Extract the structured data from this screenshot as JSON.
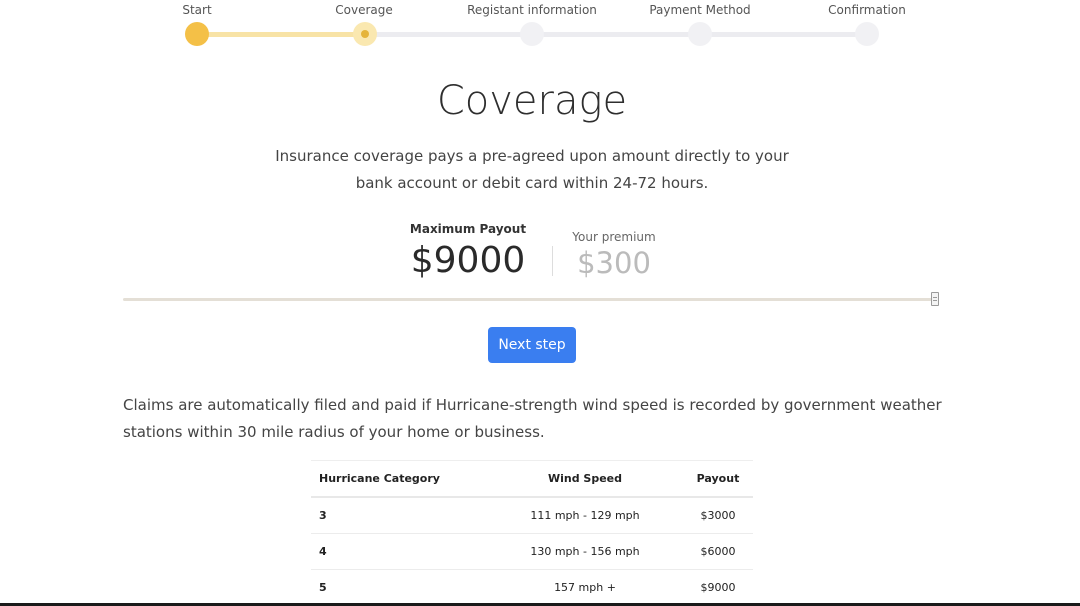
{
  "stepper": {
    "steps": [
      {
        "label": "Start",
        "state": "done"
      },
      {
        "label": "Coverage",
        "state": "current"
      },
      {
        "label": "Registant information",
        "state": "pending"
      },
      {
        "label": "Payment Method",
        "state": "pending"
      },
      {
        "label": "Confirmation",
        "state": "pending"
      }
    ],
    "colors": {
      "done": "#f4c047",
      "current": "#fae8b0",
      "pending": "#f1f1f4"
    }
  },
  "page": {
    "title": "Coverage",
    "intro": "Insurance coverage pays a pre-agreed upon amount directly to your bank account or debit card within 24-72 hours."
  },
  "coverage": {
    "max_payout_label": "Maximum Payout",
    "max_payout_value": "$9000",
    "premium_label": "Your premium",
    "premium_value": "$300",
    "slider_level": 1.0
  },
  "actions": {
    "next_label": "Next step",
    "accent_color": "#3a7ef0"
  },
  "claims_text": "Claims are automatically filed and paid if Hurricane-strength wind speed is recorded by government weather stations within 30 mile radius of your home or business.",
  "table": {
    "headers": [
      "Hurricane Category",
      "Wind Speed",
      "Payout"
    ],
    "rows": [
      [
        "3",
        "111 mph - 129 mph",
        "$3000"
      ],
      [
        "4",
        "130 mph - 156 mph",
        "$6000"
      ],
      [
        "5",
        "157 mph +",
        "$9000"
      ]
    ]
  }
}
